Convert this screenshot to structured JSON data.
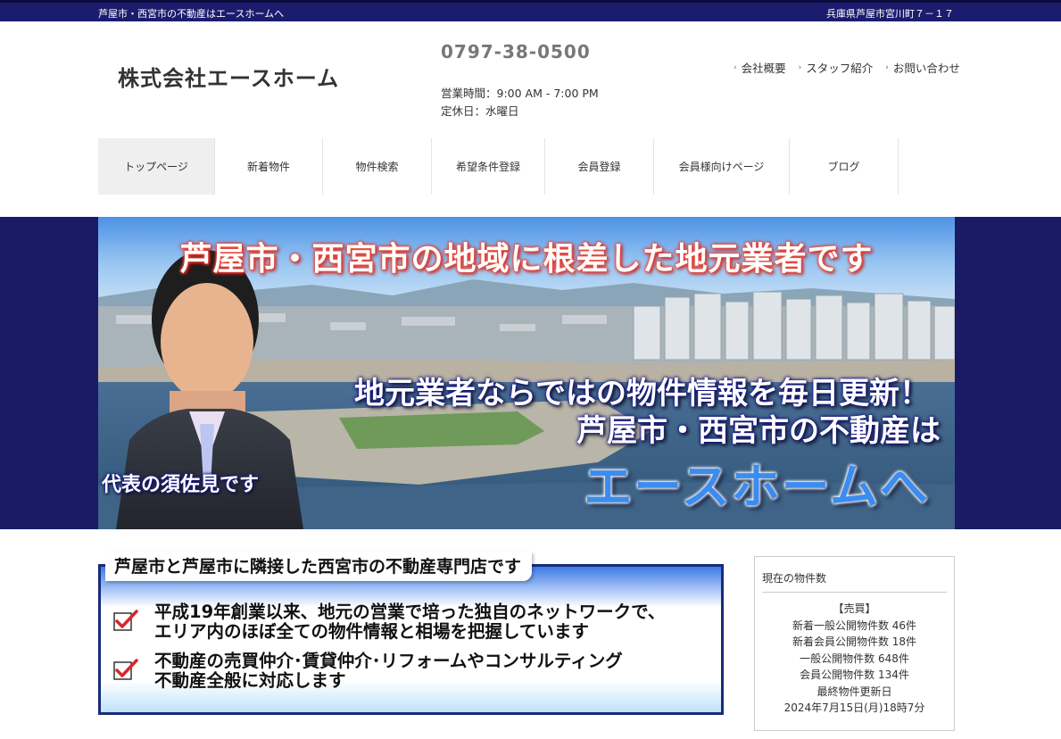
{
  "topbar": {
    "tagline": "芦屋市・西宮市の不動産はエースホームへ",
    "address": "兵庫県芦屋市宮川町７－１７"
  },
  "header": {
    "company_name": "株式会社エースホーム",
    "phone": "0797-38-0500",
    "hours": "営業時間：9:00 AM - 7:00 PM",
    "closed": "定休日：水曜日",
    "util_links": [
      "会社概要",
      "スタッフ紹介",
      "お問い合わせ"
    ]
  },
  "nav": {
    "tabs": [
      "トップページ",
      "新着物件",
      "物件検索",
      "希望条件登録",
      "会員登録",
      "会員様向けページ",
      "ブログ"
    ]
  },
  "hero": {
    "headline": "芦屋市・西宮市の地域に根差した地元業者です",
    "line1": "地元業者ならではの物件情報を毎日更新！",
    "line2": "芦屋市・西宮市の不動産は",
    "line3": "エースホームへ",
    "caption": "代表の須佐見です"
  },
  "intro": {
    "heading": "芦屋市と芦屋市に隣接した西宮市の不動産専門店です",
    "items": [
      {
        "line1": "平成19年創業以来、地元の営業で培った独自のネットワークで、",
        "line2": "エリア内のほぼ全ての物件情報と相場を把握しています"
      },
      {
        "line1": "不動産の売買仲介･賃貸仲介･リフォームやコンサルティング",
        "line2": "不動産全般に対応します"
      }
    ]
  },
  "sidebar": {
    "title": "現在の物件数",
    "category": "【売買】",
    "stats": [
      "新着一般公開物件数 46件",
      "新着会員公開物件数 18件",
      "一般公開物件数 648件",
      "会員公開物件数 134件",
      "最終物件更新日",
      "2024年7月15日(月)18時7分"
    ]
  },
  "colors": {
    "navy": "#1c1c6e",
    "accent_blue": "#3b8cf0",
    "headline_red": "#e94a3a",
    "check_red": "#d8262a"
  },
  "icons": [
    "chevron-right-icon",
    "checkmark-icon"
  ]
}
